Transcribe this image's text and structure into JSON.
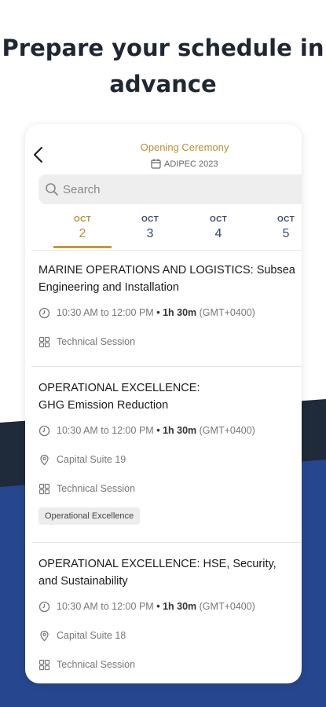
{
  "headline": [
    "Prepare your schedule in",
    "advance"
  ],
  "colors": {
    "accent": "#b8912e",
    "navy": "#26478f",
    "dark": "#1f2a3a"
  },
  "header": {
    "title": "Opening Ceremony",
    "subtitle": "ADIPEC 2023",
    "back_icon": "chevron-left-icon"
  },
  "search": {
    "placeholder": "Search"
  },
  "tabs": [
    {
      "month": "OCT",
      "day": "2",
      "active": true
    },
    {
      "month": "OCT",
      "day": "3",
      "active": false
    },
    {
      "month": "OCT",
      "day": "4",
      "active": false
    },
    {
      "month": "OCT",
      "day": "5",
      "active": false
    }
  ],
  "sessions": [
    {
      "title": "MARINE OPERATIONS AND LOGISTICS: Subsea Engineering and Installation",
      "time": "10:30 AM to 12:00 PM",
      "sep": "•",
      "duration": "1h 30m",
      "tz": "(GMT+0400)",
      "type": "Technical Session"
    },
    {
      "title": "OPERATIONAL EXCELLENCE: GHG Emission Reduction",
      "time": "10:30 AM to 12:00 PM",
      "sep": "•",
      "duration": "1h 30m",
      "tz": "(GMT+0400)",
      "location": "Capital Suite 19",
      "type": "Technical Session",
      "tag": "Operational Excellence"
    },
    {
      "title": "OPERATIONAL EXCELLENCE: HSE, Security, and Sustainability",
      "time": "10:30 AM to 12:00 PM",
      "sep": "•",
      "duration": "1h 30m",
      "tz": "(GMT+0400)",
      "location": "Capital Suite 18",
      "type": "Technical Session"
    }
  ]
}
